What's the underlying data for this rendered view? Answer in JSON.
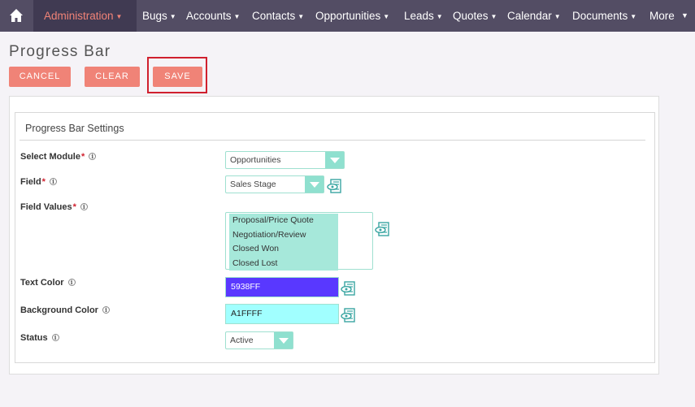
{
  "nav": {
    "items": [
      {
        "label": "Administration"
      },
      {
        "label": "Bugs"
      },
      {
        "label": "Accounts"
      },
      {
        "label": "Contacts"
      },
      {
        "label": "Opportunities"
      },
      {
        "label": "Leads"
      },
      {
        "label": "Quotes"
      },
      {
        "label": "Calendar"
      },
      {
        "label": "Documents"
      },
      {
        "label": "More"
      }
    ],
    "home_icon": "home-icon",
    "active_color": "#f08377",
    "bg_color": "#534d64"
  },
  "page": {
    "title": "Progress Bar"
  },
  "actions": {
    "cancel": "CANCEL",
    "clear": "CLEAR",
    "save": "SAVE",
    "button_color": "#f08377",
    "highlight_color": "#d0202e"
  },
  "panel": {
    "title": "Progress Bar Settings"
  },
  "form": {
    "select_module": {
      "label": "Select Module",
      "required": "*",
      "value": "Opportunities"
    },
    "field": {
      "label": "Field",
      "required": "*",
      "value": "Sales Stage"
    },
    "field_values": {
      "label": "Field Values",
      "required": "*",
      "options": [
        "Proposal/Price Quote",
        "Negotiation/Review",
        "Closed Won",
        "Closed Lost"
      ]
    },
    "text_color": {
      "label": "Text Color",
      "value": "5938FF"
    },
    "background_color": {
      "label": "Background Color",
      "value": "A1FFFF"
    },
    "status": {
      "label": "Status",
      "value": "Active"
    }
  },
  "info_glyph": "i",
  "icons": {
    "info": "info-icon",
    "field_picker": "field-picker-icon"
  }
}
